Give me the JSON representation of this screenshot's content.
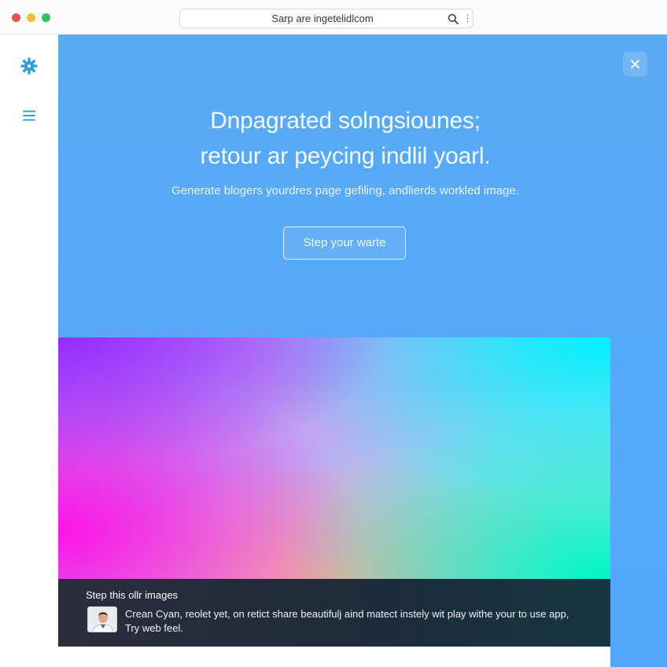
{
  "browser": {
    "url": "Sarp are ingetelidlcom",
    "search_icon": "search-icon",
    "more_icon": "more-vertical-icon"
  },
  "sidebar": {
    "items": [
      {
        "icon": "gear-icon"
      },
      {
        "icon": "hamburger-menu-icon"
      }
    ]
  },
  "hero": {
    "headline_line1": "Dnpagrated solngsiounes;",
    "headline_line2": "retour ar peycing indlil yoarl.",
    "subheadline": "Generate blogers yourdres page gefiling, andlierds workled image.",
    "cta_label": "Step your warte",
    "close_icon": "close-icon"
  },
  "caption": {
    "title": "Step this ollr images",
    "text": "Crean Cyan, reolet yet, on retict share beautifulj aind matect instely wit play withe your to use app, Try web feel."
  },
  "colors": {
    "hero_bg": "#56a8f8",
    "accent": "#2e9fd8",
    "caption_bg": "#1f2c3a"
  }
}
